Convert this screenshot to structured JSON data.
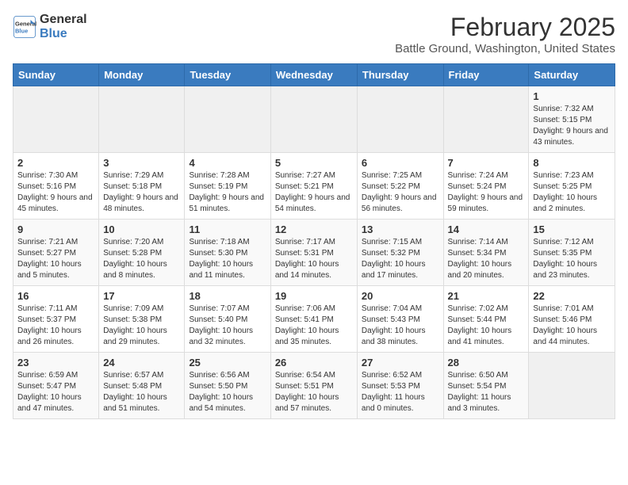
{
  "header": {
    "logo_line1": "General",
    "logo_line2": "Blue",
    "month_title": "February 2025",
    "location": "Battle Ground, Washington, United States"
  },
  "weekdays": [
    "Sunday",
    "Monday",
    "Tuesday",
    "Wednesday",
    "Thursday",
    "Friday",
    "Saturday"
  ],
  "weeks": [
    [
      {
        "day": "",
        "info": ""
      },
      {
        "day": "",
        "info": ""
      },
      {
        "day": "",
        "info": ""
      },
      {
        "day": "",
        "info": ""
      },
      {
        "day": "",
        "info": ""
      },
      {
        "day": "",
        "info": ""
      },
      {
        "day": "1",
        "info": "Sunrise: 7:32 AM\nSunset: 5:15 PM\nDaylight: 9 hours and 43 minutes."
      }
    ],
    [
      {
        "day": "2",
        "info": "Sunrise: 7:30 AM\nSunset: 5:16 PM\nDaylight: 9 hours and 45 minutes."
      },
      {
        "day": "3",
        "info": "Sunrise: 7:29 AM\nSunset: 5:18 PM\nDaylight: 9 hours and 48 minutes."
      },
      {
        "day": "4",
        "info": "Sunrise: 7:28 AM\nSunset: 5:19 PM\nDaylight: 9 hours and 51 minutes."
      },
      {
        "day": "5",
        "info": "Sunrise: 7:27 AM\nSunset: 5:21 PM\nDaylight: 9 hours and 54 minutes."
      },
      {
        "day": "6",
        "info": "Sunrise: 7:25 AM\nSunset: 5:22 PM\nDaylight: 9 hours and 56 minutes."
      },
      {
        "day": "7",
        "info": "Sunrise: 7:24 AM\nSunset: 5:24 PM\nDaylight: 9 hours and 59 minutes."
      },
      {
        "day": "8",
        "info": "Sunrise: 7:23 AM\nSunset: 5:25 PM\nDaylight: 10 hours and 2 minutes."
      }
    ],
    [
      {
        "day": "9",
        "info": "Sunrise: 7:21 AM\nSunset: 5:27 PM\nDaylight: 10 hours and 5 minutes."
      },
      {
        "day": "10",
        "info": "Sunrise: 7:20 AM\nSunset: 5:28 PM\nDaylight: 10 hours and 8 minutes."
      },
      {
        "day": "11",
        "info": "Sunrise: 7:18 AM\nSunset: 5:30 PM\nDaylight: 10 hours and 11 minutes."
      },
      {
        "day": "12",
        "info": "Sunrise: 7:17 AM\nSunset: 5:31 PM\nDaylight: 10 hours and 14 minutes."
      },
      {
        "day": "13",
        "info": "Sunrise: 7:15 AM\nSunset: 5:32 PM\nDaylight: 10 hours and 17 minutes."
      },
      {
        "day": "14",
        "info": "Sunrise: 7:14 AM\nSunset: 5:34 PM\nDaylight: 10 hours and 20 minutes."
      },
      {
        "day": "15",
        "info": "Sunrise: 7:12 AM\nSunset: 5:35 PM\nDaylight: 10 hours and 23 minutes."
      }
    ],
    [
      {
        "day": "16",
        "info": "Sunrise: 7:11 AM\nSunset: 5:37 PM\nDaylight: 10 hours and 26 minutes."
      },
      {
        "day": "17",
        "info": "Sunrise: 7:09 AM\nSunset: 5:38 PM\nDaylight: 10 hours and 29 minutes."
      },
      {
        "day": "18",
        "info": "Sunrise: 7:07 AM\nSunset: 5:40 PM\nDaylight: 10 hours and 32 minutes."
      },
      {
        "day": "19",
        "info": "Sunrise: 7:06 AM\nSunset: 5:41 PM\nDaylight: 10 hours and 35 minutes."
      },
      {
        "day": "20",
        "info": "Sunrise: 7:04 AM\nSunset: 5:43 PM\nDaylight: 10 hours and 38 minutes."
      },
      {
        "day": "21",
        "info": "Sunrise: 7:02 AM\nSunset: 5:44 PM\nDaylight: 10 hours and 41 minutes."
      },
      {
        "day": "22",
        "info": "Sunrise: 7:01 AM\nSunset: 5:46 PM\nDaylight: 10 hours and 44 minutes."
      }
    ],
    [
      {
        "day": "23",
        "info": "Sunrise: 6:59 AM\nSunset: 5:47 PM\nDaylight: 10 hours and 47 minutes."
      },
      {
        "day": "24",
        "info": "Sunrise: 6:57 AM\nSunset: 5:48 PM\nDaylight: 10 hours and 51 minutes."
      },
      {
        "day": "25",
        "info": "Sunrise: 6:56 AM\nSunset: 5:50 PM\nDaylight: 10 hours and 54 minutes."
      },
      {
        "day": "26",
        "info": "Sunrise: 6:54 AM\nSunset: 5:51 PM\nDaylight: 10 hours and 57 minutes."
      },
      {
        "day": "27",
        "info": "Sunrise: 6:52 AM\nSunset: 5:53 PM\nDaylight: 11 hours and 0 minutes."
      },
      {
        "day": "28",
        "info": "Sunrise: 6:50 AM\nSunset: 5:54 PM\nDaylight: 11 hours and 3 minutes."
      },
      {
        "day": "",
        "info": ""
      }
    ]
  ]
}
